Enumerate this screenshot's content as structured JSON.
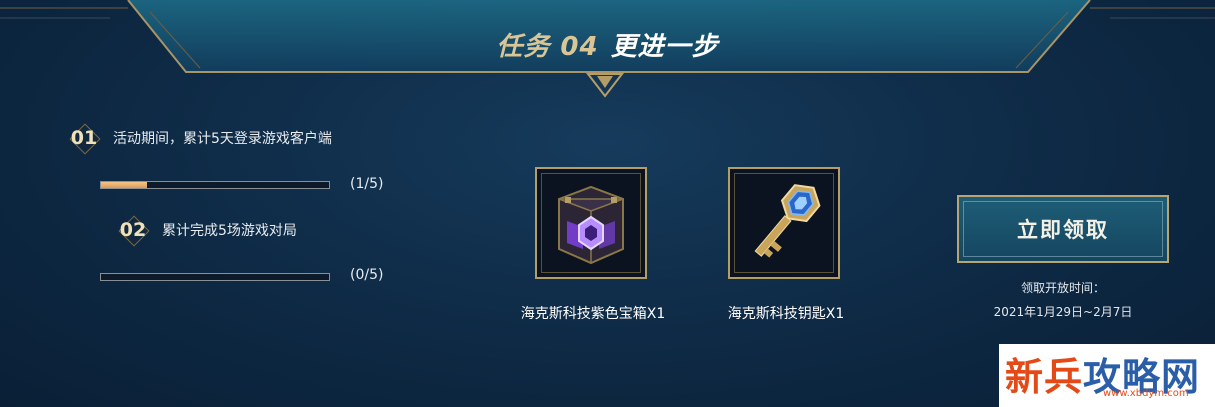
{
  "header": {
    "task_number": "任务 04",
    "task_title": "更进一步"
  },
  "tasks": [
    {
      "badge": "01",
      "text": "活动期间，累计5天登录游戏客户端",
      "progress_text": "(1/5)",
      "progress_value": 0.2
    },
    {
      "badge": "02",
      "text": "累计完成5场游戏对局",
      "progress_text": "(0/5)",
      "progress_value": 0
    }
  ],
  "rewards": [
    {
      "name": "海克斯科技紫色宝箱X1",
      "icon": "purple-chest-icon"
    },
    {
      "name": "海克斯科技钥匙X1",
      "icon": "key-icon"
    }
  ],
  "claim": {
    "label": "立即领取",
    "note_label": "领取开放时间：",
    "note_dates": "2021年1月29日~2月7日"
  },
  "watermark": {
    "part1": "新兵",
    "part2": "攻略网",
    "url": "www.xbdym.com"
  },
  "colors": {
    "background": "#0f2c48",
    "gold": "#b59d66",
    "progress_fill": "#e09a55",
    "button": "#1e5d77"
  }
}
